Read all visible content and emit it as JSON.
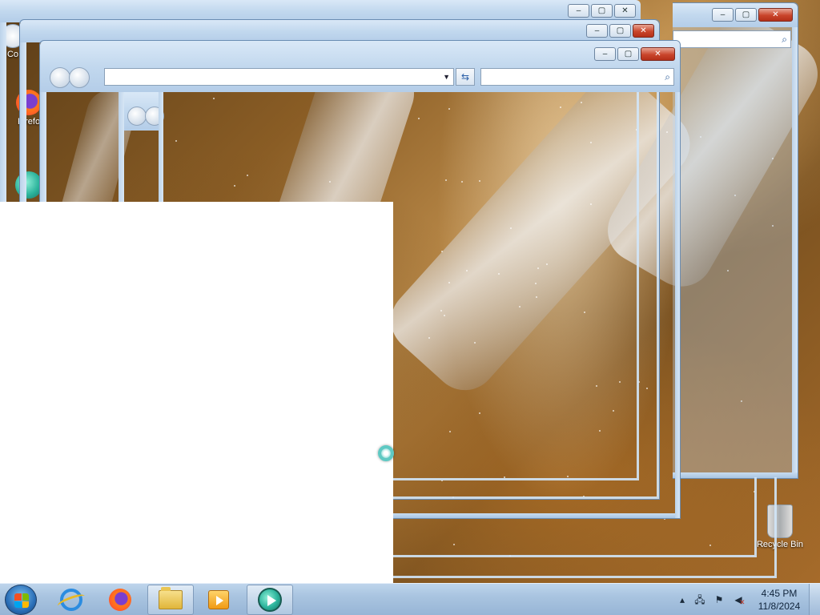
{
  "desktop": {
    "icons": [
      {
        "label": "Co",
        "icon": "computer-icon"
      },
      {
        "label": "Firefo",
        "icon": "firefox-icon"
      },
      {
        "label": "",
        "icon": "app-icon"
      },
      {
        "label": "Recycle Bin",
        "icon": "recycle-bin-icon"
      }
    ]
  },
  "windows": [
    {
      "name": "window-back",
      "address": "",
      "search": "",
      "caption": {
        "minimize": "–",
        "maximize": "▢",
        "close": "✕"
      }
    },
    {
      "name": "window-middle",
      "address": "",
      "search": "",
      "caption": {
        "minimize": "–",
        "maximize": "▢",
        "close": "✕"
      }
    },
    {
      "name": "window-mid-front",
      "address": "",
      "search": "",
      "caption": {
        "minimize": "–",
        "maximize": "▢",
        "close": "✕"
      }
    },
    {
      "name": "window-front",
      "address": "",
      "search": "",
      "caption": {
        "minimize": "–",
        "maximize": "▢",
        "close": "✕"
      }
    }
  ],
  "taskbar": {
    "start_icon": "windows-start-orb-icon",
    "pinned": [
      {
        "name": "internet-explorer",
        "icon": "internet-explorer-icon",
        "active": false
      },
      {
        "name": "firefox",
        "icon": "firefox-icon",
        "active": false
      },
      {
        "name": "file-explorer",
        "icon": "folder-icon",
        "active": true
      },
      {
        "name": "media-player",
        "icon": "media-player-icon",
        "active": false
      },
      {
        "name": "app",
        "icon": "app-icon",
        "active": true
      }
    ],
    "tray": {
      "overflow": "▴",
      "icons": [
        "network-icon",
        "action-center-flag-icon",
        "volume-muted-icon"
      ]
    },
    "clock": {
      "time": "4:45 PM",
      "date": "11/8/2024"
    }
  },
  "cursor": {
    "state": "busy",
    "icon": "busy-cursor-icon"
  },
  "colors": {
    "aero_frame": "#bcd3ea",
    "close_button": "#c9452c",
    "taskbar": "#a9c4e0"
  }
}
